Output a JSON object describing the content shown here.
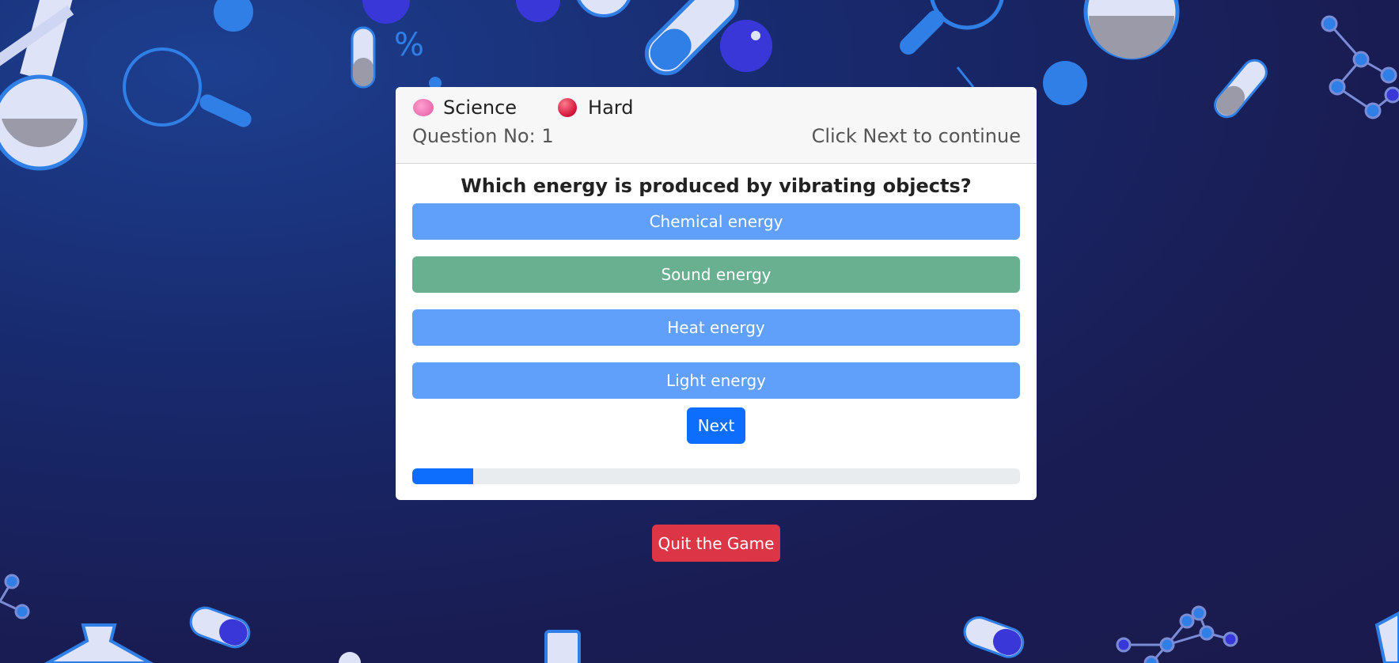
{
  "quiz": {
    "category_icon": "brain-icon",
    "category": "Science",
    "difficulty_icon": "red-circle-icon",
    "difficulty": "Hard",
    "question_number_label": "Question No: 1",
    "instruction": "Click Next to continue",
    "question": "Which energy is produced by vibrating objects?",
    "options": [
      {
        "label": "Chemical energy",
        "state": "default"
      },
      {
        "label": "Sound energy",
        "state": "correct"
      },
      {
        "label": "Heat energy",
        "state": "default"
      },
      {
        "label": "Light energy",
        "state": "default"
      }
    ],
    "next_label": "Next",
    "progress_fraction": 0.1
  },
  "quit_label": "Quit the Game",
  "colors": {
    "option_default": "#60a0fb",
    "option_correct": "#69b090",
    "primary": "#0d6efd",
    "danger": "#dc3545"
  }
}
